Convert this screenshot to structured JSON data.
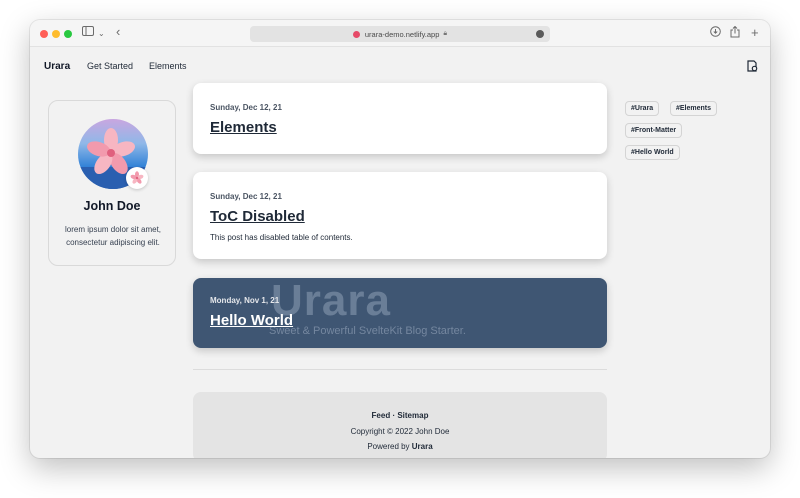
{
  "browser": {
    "url": "urara-demo.netlify.app"
  },
  "site": {
    "brand": "Urara",
    "nav": [
      {
        "label": "Get Started"
      },
      {
        "label": "Elements"
      }
    ]
  },
  "profile": {
    "name": "John Doe",
    "bio": "lorem ipsum dolor sit amet, consectetur adipiscing elit."
  },
  "posts": [
    {
      "date": "Sunday, Dec 12, 21",
      "title": "Elements",
      "description": ""
    },
    {
      "date": "Sunday, Dec 12, 21",
      "title": "ToC Disabled",
      "description": "This post has disabled table of contents."
    },
    {
      "date": "Monday, Nov 1, 21",
      "title": "Hello World",
      "description": "",
      "cover_title": "Urara",
      "cover_subtitle": "Sweet & Powerful SvelteKit Blog Starter."
    }
  ],
  "footer": {
    "links_line": "Feed · Sitemap",
    "copyright": "Copyright © 2022 John Doe",
    "powered_prefix": "Powered by ",
    "powered_name": "Urara"
  },
  "tags": [
    "#Urara",
    "#Elements",
    "#Front-Matter",
    "#Hello World"
  ],
  "colors": {
    "dark_card": "#3f5673",
    "traffic_red": "#ff5f57",
    "traffic_yellow": "#febc2e",
    "traffic_green": "#28c840"
  }
}
